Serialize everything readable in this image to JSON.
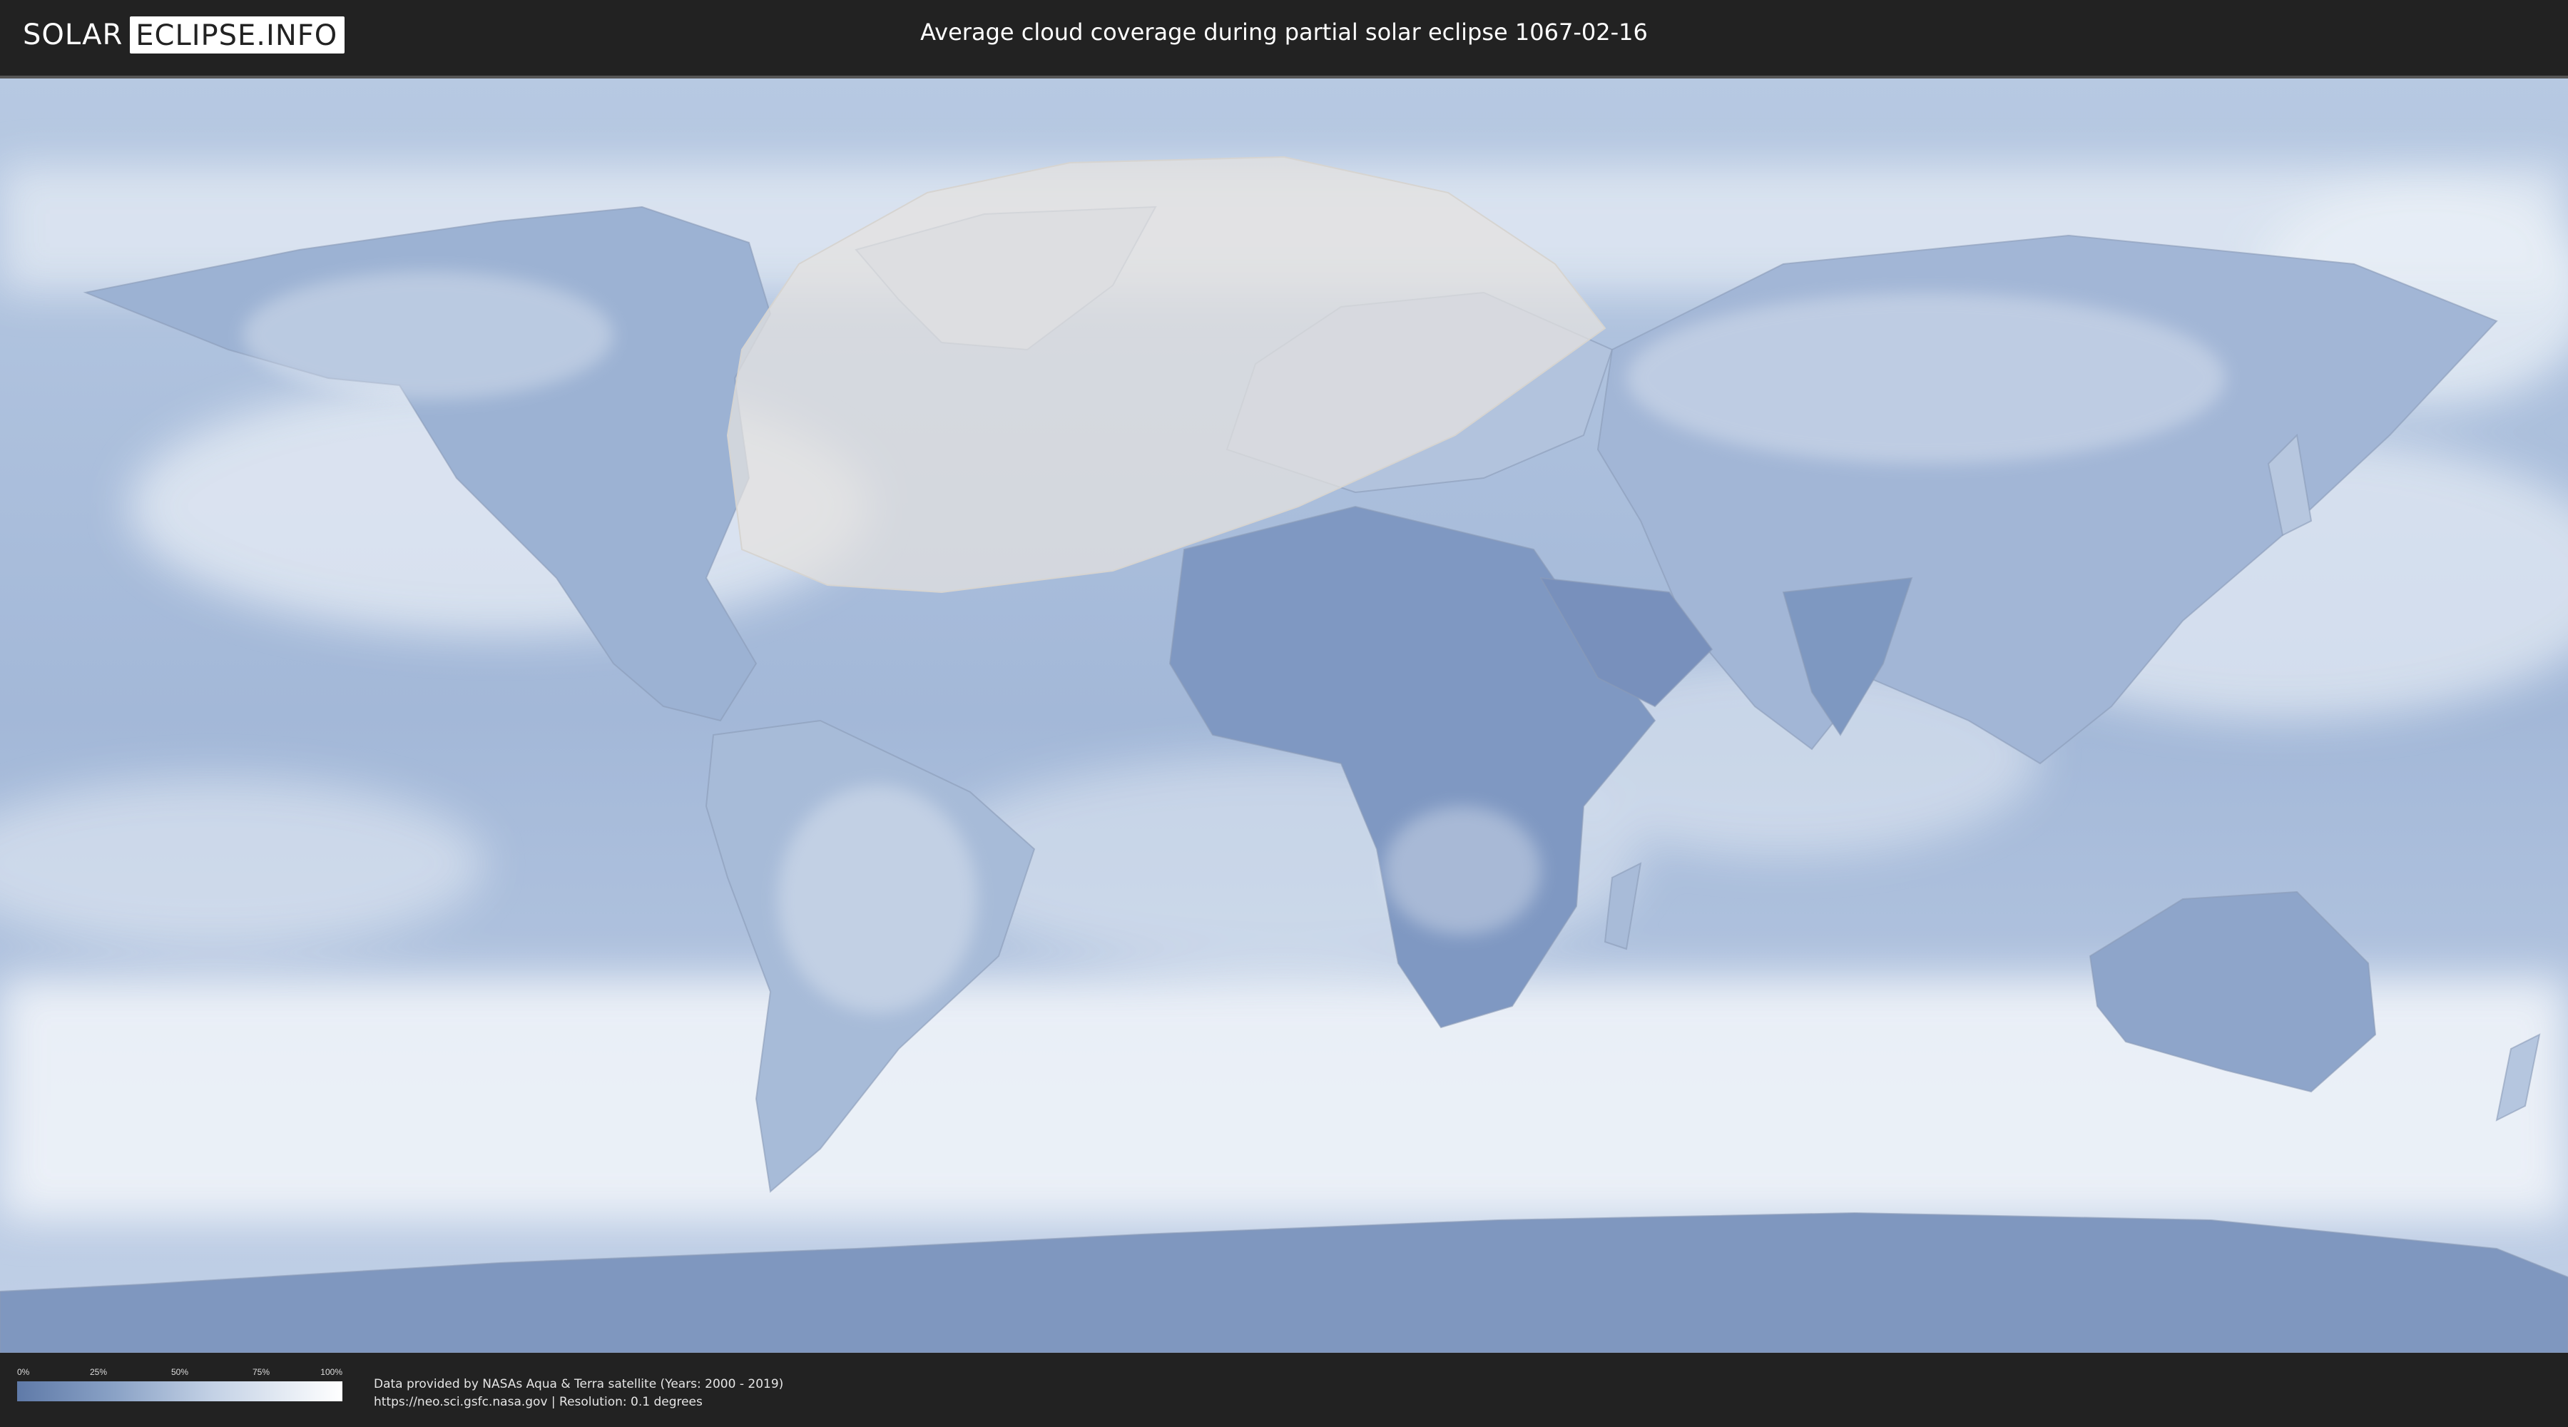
{
  "header": {
    "logo_solar": "SOLAR",
    "logo_eclipse": "ECLIPSE.INFO",
    "title": "Average cloud coverage during partial solar eclipse 1067-02-16"
  },
  "map": {
    "icon": "world-cloud-map",
    "colors": {
      "ocean": "#a9bddb",
      "cloud": "#f4f7fb",
      "land": "#7e98c1",
      "dry_land": "#6f89b5",
      "eclipse_zone": "#e4e2df"
    }
  },
  "legend": {
    "ticks": [
      "0%",
      "25%",
      "50%",
      "75%",
      "100%"
    ],
    "color_low": "#5f7aa8",
    "color_high": "#ffffff"
  },
  "footer": {
    "credit_line1": "Data provided by NASAs Aqua & Terra satellite (Years: 2000 - 2019)",
    "credit_line2": "https://neo.sci.gsfc.nasa.gov | Resolution: 0.1 degrees"
  }
}
